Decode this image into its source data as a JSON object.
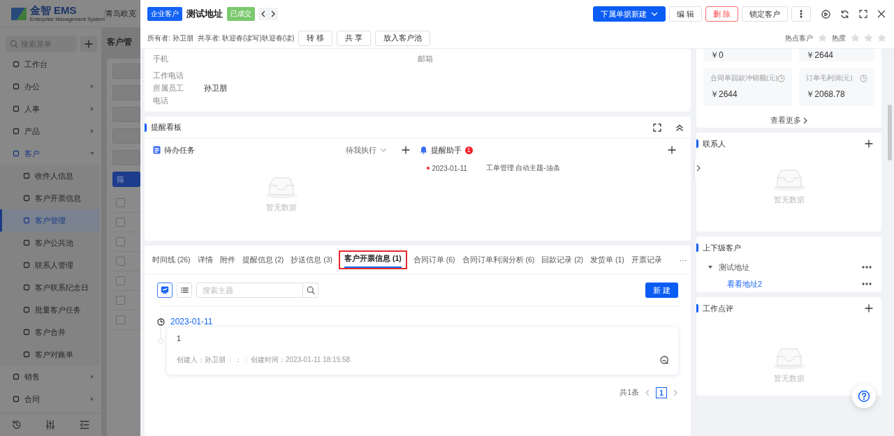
{
  "app": {
    "brand": "金智 EMS",
    "brand_subtitle": "Enterprise Management System",
    "company": "青岛欧克",
    "search": {
      "placeholder": "搜索菜单"
    },
    "menu": [
      {
        "kind": "item",
        "label": "工作台"
      },
      {
        "kind": "group",
        "label": "办公",
        "expanded": false
      },
      {
        "kind": "group",
        "label": "人事",
        "expanded": false
      },
      {
        "kind": "group",
        "label": "产品",
        "expanded": false
      },
      {
        "kind": "group",
        "label": "客户",
        "expanded": true,
        "children": [
          {
            "label": "收件人信息",
            "selected": false
          },
          {
            "label": "客户开票信息",
            "selected": false
          },
          {
            "label": "客户管理",
            "selected": true
          },
          {
            "label": "客户公共池",
            "selected": false
          },
          {
            "label": "联系人管理",
            "selected": false
          },
          {
            "label": "客户联系纪念日",
            "selected": false
          },
          {
            "label": "批量客户任务",
            "selected": false
          },
          {
            "label": "客户合并",
            "selected": false
          },
          {
            "label": "客户对账单",
            "selected": false
          }
        ]
      },
      {
        "kind": "group",
        "label": "销售",
        "expanded": false
      },
      {
        "kind": "group",
        "label": "合同",
        "expanded": false
      }
    ],
    "page_title": "客户管",
    "filter_button": "筛",
    "table_rows": [
      {
        "checked": false
      },
      {
        "checked": false
      },
      {
        "checked": false
      },
      {
        "checked": false
      },
      {
        "checked": false
      },
      {
        "checked": false
      },
      {
        "checked": false
      }
    ]
  },
  "header": {
    "type_tag": "企业客户",
    "title": "测试地址",
    "status_tag": "已成交",
    "actions": [
      {
        "label": "下属单据新建",
        "kind": "primary"
      },
      {
        "label": "编 辑",
        "kind": "default"
      },
      {
        "label": "删 除",
        "kind": "danger"
      },
      {
        "label": "锁定客户",
        "kind": "default"
      }
    ]
  },
  "meta": {
    "owner": "所有者: 孙卫朋",
    "sharer": "共享者: 耿迎春(读写)耿迎春(读)",
    "buttons": [
      "转 移",
      "共 享",
      "放入客户池"
    ],
    "hot_customer": {
      "label": "热点客户",
      "on": false
    },
    "heat": {
      "label": "热度",
      "stars": 0
    }
  },
  "details": {
    "left_fields": [
      {
        "label": "手机"
      },
      {
        "label": "工作电话"
      },
      {
        "label": "所属员工",
        "value": "孙卫朋"
      },
      {
        "label": "电话"
      }
    ],
    "right_fields": [
      {
        "label": "邮箱"
      }
    ]
  },
  "reminder_board": {
    "title": "提醒看板",
    "todo": {
      "title": "待办任务",
      "filter": "待我执行",
      "empty": "暂无数据"
    },
    "assistant": {
      "title": "提醒助手",
      "badge": "1",
      "items": [
        {
          "date": "2023-01-11",
          "text": "工单管理 自动主题-油条"
        }
      ]
    }
  },
  "record_tabs": {
    "tabs": [
      {
        "label": "时间线 (26)",
        "selected": false
      },
      {
        "label": "详情",
        "selected": false
      },
      {
        "label": "附件",
        "selected": false
      },
      {
        "label": "提醒信息 (2)",
        "selected": false
      },
      {
        "label": "抄送信息 (3)",
        "selected": false
      },
      {
        "label": "客户开票信息 (1)",
        "selected": true
      },
      {
        "label": "合同订单 (6)",
        "selected": false
      },
      {
        "label": "合同订单利润分析 (6)",
        "selected": false
      },
      {
        "label": "回款记录 (2)",
        "selected": false
      },
      {
        "label": "发货单 (1)",
        "selected": false
      },
      {
        "label": "开票记录",
        "selected": false
      }
    ],
    "more": "···",
    "view_modes": [
      {
        "kind": "timeline",
        "selected": true
      },
      {
        "kind": "list",
        "selected": false
      }
    ],
    "search": {
      "placeholder": "搜索主题"
    },
    "new_button": "新 建",
    "timeline": [
      {
        "date": "2023-01-11",
        "entries": [
          {
            "content": "1",
            "creator": "创建人：孙卫朋",
            "separator": "：",
            "created": "创建时间：2023-01-11 18:15:58"
          }
        ]
      }
    ],
    "pagination": {
      "total": "共1条",
      "pages": [
        {
          "label": "1",
          "selected": true
        }
      ]
    }
  },
  "stats": {
    "items": [
      {
        "value": "￥0"
      },
      {
        "value": "￥2644"
      },
      {
        "label": "合同单回款冲销额(元)",
        "value": "￥2644"
      },
      {
        "label": "订单毛利润(元)",
        "value": "￥2068.78"
      }
    ],
    "more": "查看更多"
  },
  "contacts": {
    "title": "联系人",
    "empty": "暂无数据"
  },
  "hierarchy": {
    "title": "上下级客户",
    "tree": [
      {
        "label": "测试地址",
        "expanded": true,
        "children": [
          {
            "label": "看看地址2"
          }
        ]
      }
    ]
  },
  "reviews": {
    "title": "工作点评",
    "empty": "暂无数据"
  }
}
